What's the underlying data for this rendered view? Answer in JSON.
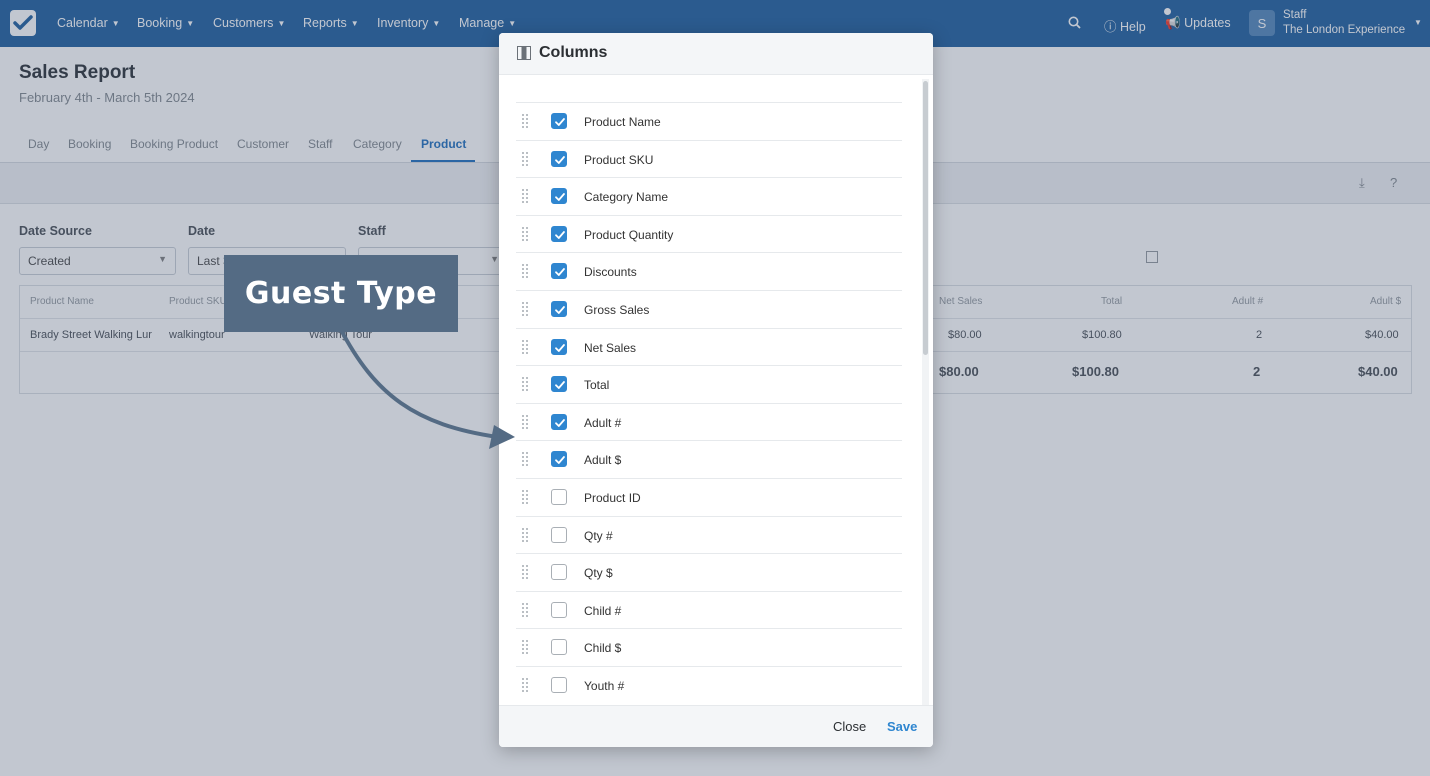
{
  "nav": {
    "items": [
      "Calendar",
      "Booking",
      "Customers",
      "Reports",
      "Inventory",
      "Manage"
    ],
    "help": "Help",
    "updates": "Updates",
    "user_initial": "S",
    "user_name": "Staff",
    "user_org": "The London Experience"
  },
  "page": {
    "title": "Sales Report",
    "subtitle": "February 4th - March 5th 2024",
    "tabs": [
      "Day",
      "Booking",
      "Booking Product",
      "Customer",
      "Staff",
      "Category",
      "Product"
    ],
    "active_tab": "Product"
  },
  "filters": {
    "date_source": {
      "label": "Date Source",
      "value": "Created"
    },
    "date": {
      "label": "Date",
      "value": "Last 30 days"
    },
    "staff": {
      "label": "Staff",
      "value": ""
    }
  },
  "table": {
    "headers": [
      "Product Name",
      "Product SKU",
      "Net Sales",
      "Total",
      "Adult #",
      "Adult $"
    ],
    "row": {
      "product_name": "Brady Street Walking Lur",
      "product_sku": "walkingtour",
      "category": "Walking Tour",
      "net_sales": "$80.00",
      "total": "$100.80",
      "adult_qty": "2",
      "adult_amount": "$40.00"
    },
    "totals": {
      "net_sales": "$80.00",
      "total": "$100.80",
      "adult_qty": "2",
      "adult_amount": "$40.00"
    }
  },
  "modal": {
    "title": "Columns",
    "columns": [
      {
        "label": "Product Name",
        "checked": true
      },
      {
        "label": "Product SKU",
        "checked": true
      },
      {
        "label": "Category Name",
        "checked": true
      },
      {
        "label": "Product Quantity",
        "checked": true
      },
      {
        "label": "Discounts",
        "checked": true
      },
      {
        "label": "Gross Sales",
        "checked": true
      },
      {
        "label": "Net Sales",
        "checked": true
      },
      {
        "label": "Total",
        "checked": true
      },
      {
        "label": "Adult #",
        "checked": true
      },
      {
        "label": "Adult $",
        "checked": true
      },
      {
        "label": "Product ID",
        "checked": false
      },
      {
        "label": "Qty #",
        "checked": false
      },
      {
        "label": "Qty $",
        "checked": false
      },
      {
        "label": "Child #",
        "checked": false
      },
      {
        "label": "Child $",
        "checked": false
      },
      {
        "label": "Youth #",
        "checked": false
      }
    ],
    "close_label": "Close",
    "save_label": "Save"
  },
  "callout": {
    "text": "Guest Type"
  }
}
